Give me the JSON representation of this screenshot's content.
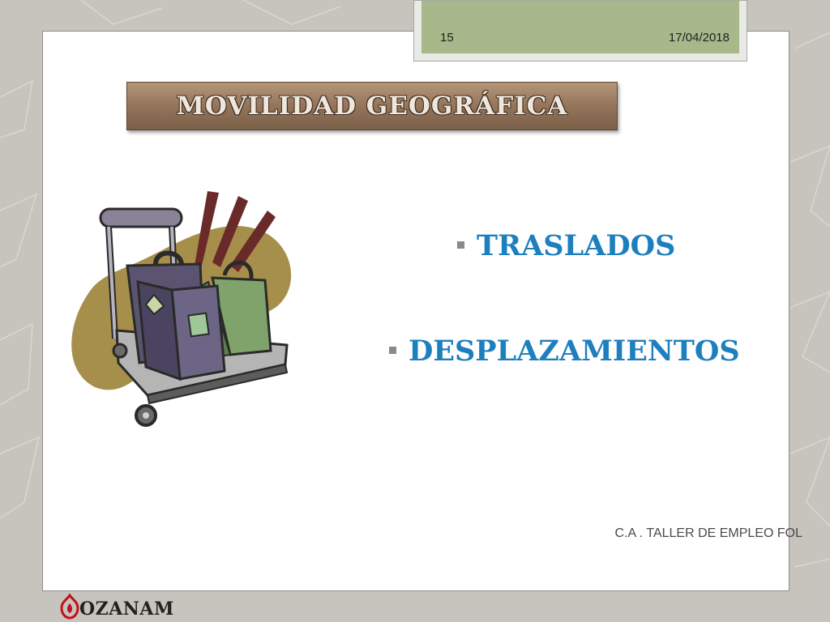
{
  "header": {
    "slide_number": "15",
    "date": "17/04/2018"
  },
  "title": "MOVILIDAD GEOGRÁFICA",
  "bullets": [
    {
      "text": "TRASLADOS"
    },
    {
      "text": "DESPLAZAMIENTOS"
    }
  ],
  "footer": {
    "text": "C.A . TALLER DE EMPLEO FOL"
  },
  "logo": {
    "text": "OZANAM"
  },
  "clipart": {
    "icon": "luggage-cart-icon"
  },
  "colors": {
    "header_accent": "#a7b98a",
    "banner": "#94755b",
    "bullet_text": "#1e7fbf",
    "background": "#c7c4bd"
  }
}
